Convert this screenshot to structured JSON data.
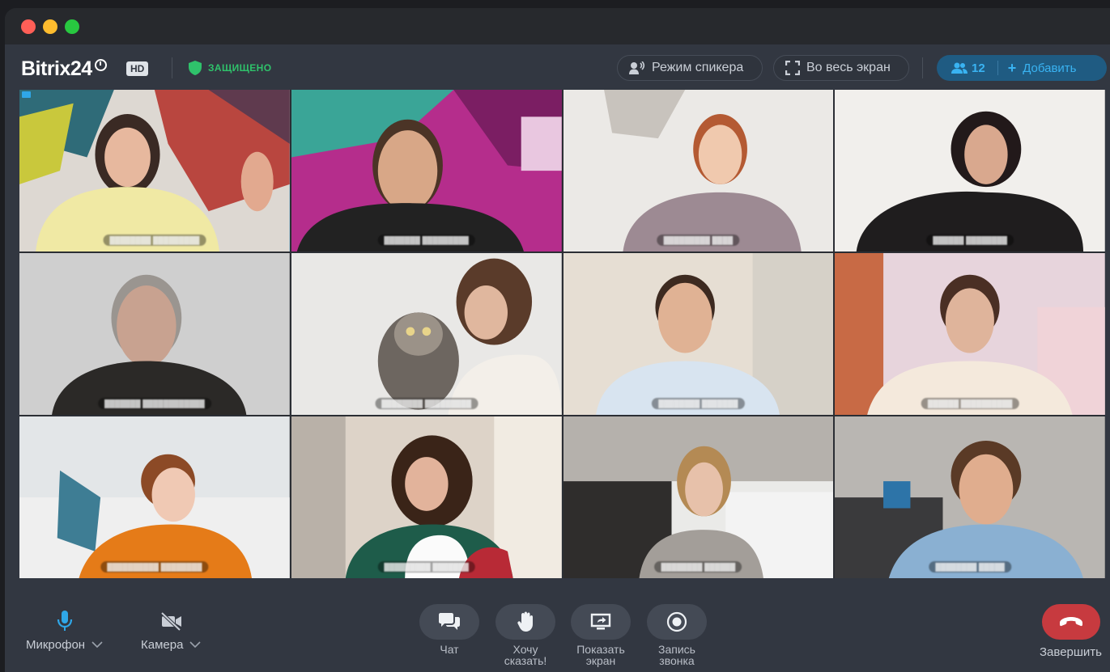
{
  "window": {
    "controls": [
      "close",
      "minimize",
      "maximize"
    ]
  },
  "header": {
    "logo_text": "Bitrix24",
    "hd_badge": "HD",
    "secure_label": "ЗАЩИЩЕНО",
    "speaker_mode_label": "Режим спикера",
    "fullscreen_label": "Во весь экран",
    "participants_count": "12",
    "add_label": "Добавить"
  },
  "colors": {
    "accent": "#2fa7e8",
    "secure": "#2fc26b",
    "end_call": "#c73a3f",
    "background": "#323741"
  },
  "tiles": [
    {
      "active": true
    },
    {
      "active": false
    },
    {
      "active": false
    },
    {
      "active": false
    },
    {
      "active": false
    },
    {
      "active": false
    },
    {
      "active": false
    },
    {
      "active": false
    },
    {
      "active": false
    },
    {
      "active": false
    },
    {
      "active": false
    },
    {
      "active": false
    }
  ],
  "controls": {
    "mic_label": "Микрофон",
    "camera_label": "Камера",
    "chat_label": "Чат",
    "raise_hand_label": "Хочу\nсказать!",
    "share_screen_label": "Показать\nэкран",
    "record_label": "Запись\nзвонка",
    "end_label": "Завершить"
  }
}
